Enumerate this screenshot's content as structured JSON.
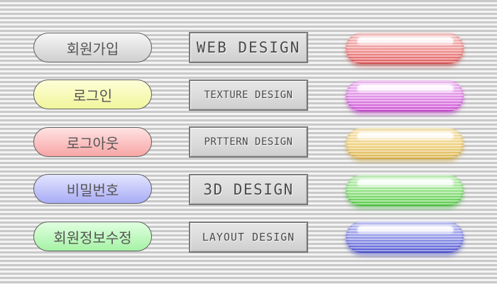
{
  "pill_buttons": [
    {
      "label": "회원가입",
      "color_top": "#f7f7f7",
      "color_bottom": "#cfcfcf"
    },
    {
      "label": "로그인",
      "color_top": "#fdffd8",
      "color_bottom": "#f1f59c"
    },
    {
      "label": "로그아웃",
      "color_top": "#ffe3e3",
      "color_bottom": "#f7a5a5"
    },
    {
      "label": "비밀번호",
      "color_top": "#e3e5ff",
      "color_bottom": "#a8acf5"
    },
    {
      "label": "회원정보수정",
      "color_top": "#e0ffe0",
      "color_bottom": "#a6f2a6"
    }
  ],
  "design_buttons": [
    {
      "label": "WEB DESIGN"
    },
    {
      "label": "TEXTURE DESIGN"
    },
    {
      "label": "PRTTERN DESIGN"
    },
    {
      "label": "3D DESIGN"
    },
    {
      "label": "LAYOUT DESIGN"
    }
  ],
  "glass_buttons": [
    {
      "color": "#e15a5a",
      "name": "red"
    },
    {
      "color": "#cc4fd4",
      "name": "magenta"
    },
    {
      "color": "#ddb652",
      "name": "yellow"
    },
    {
      "color": "#57cc48",
      "name": "green"
    },
    {
      "color": "#5157d2",
      "name": "blue"
    }
  ]
}
